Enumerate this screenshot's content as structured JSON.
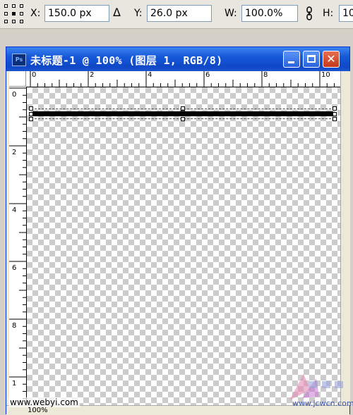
{
  "options_bar": {
    "x_label": "X:",
    "x_value": "150.0 px",
    "y_label": "Y:",
    "y_value": "26.0 px",
    "w_label": "W:",
    "w_value": "100.0%",
    "h_label": "H:",
    "h_value": "10"
  },
  "window": {
    "title": "未标题-1 @ 100% (图层 1, RGB/8)",
    "app_icon_text": "Ps",
    "zoom_text": "100%"
  },
  "rulers": {
    "horizontal_labels": [
      "0",
      "2",
      "4",
      "6",
      "8",
      "10"
    ],
    "vertical_labels": [
      "0",
      "2",
      "4",
      "6",
      "8",
      "1"
    ]
  },
  "watermarks": {
    "left": "www.webyi.com",
    "right": "www.jcwcn.com"
  },
  "colors": {
    "titlebar": "#1658d8",
    "window_border": "#0831d9",
    "close_button": "#c6381b"
  }
}
